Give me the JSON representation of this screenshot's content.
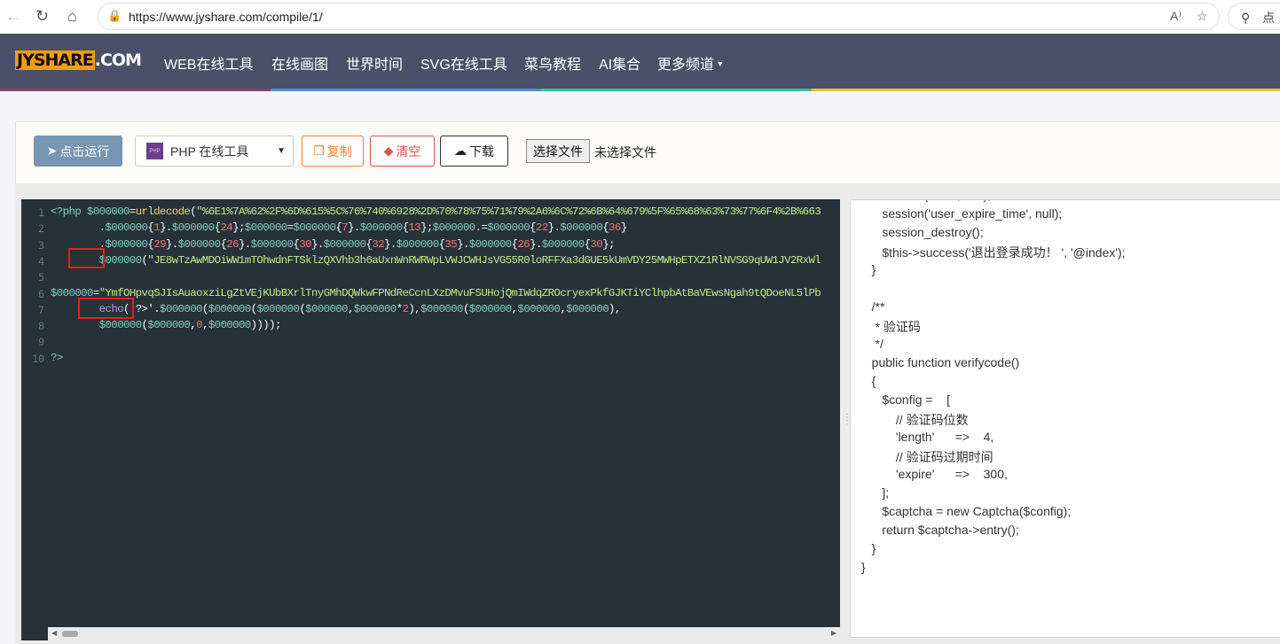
{
  "browser": {
    "url": "https://www.jyshare.com/compile/1/",
    "read_aloud": "A⁾",
    "search_text": "点"
  },
  "nav": {
    "logo_left": "JYSHARE",
    "logo_right": ".COM",
    "items": [
      "WEB在线工具",
      "在线画图",
      "世界时间",
      "SVG在线工具",
      "菜鸟教程",
      "AI集合",
      "更多频道"
    ]
  },
  "stripe_colors": [
    "#8e3f68",
    "#4a8fd6",
    "#2ec48e",
    "#f0c030"
  ],
  "toolbar": {
    "run": "点击运行",
    "language": "PHP 在线工具",
    "php_badge": "PHP",
    "copy": "复制",
    "clear": "清空",
    "download": "下载",
    "choose_file": "选择文件",
    "no_file": "未选择文件"
  },
  "editor": {
    "lines": [
      [
        [
          "t-var",
          "<?php $000000"
        ],
        [
          "t-op",
          "="
        ],
        [
          "t-fn",
          "urldecode"
        ],
        [
          "t-op",
          "("
        ],
        [
          "t-str",
          "\"%6E1%7A%62%2F%6D%615%5C%76%740%6928%2D%70%78%75%71%79%2A6%6C%72%6B%64%679%5F%65%68%63%73%77%6F4%2B%663"
        ]
      ],
      [
        [
          "t-op",
          "        ."
        ],
        [
          "t-var",
          "$000000"
        ],
        [
          "t-op",
          "{"
        ],
        [
          "t-num",
          "1"
        ],
        [
          "t-op",
          "}."
        ],
        [
          "t-var",
          "$000000"
        ],
        [
          "t-op",
          "{"
        ],
        [
          "t-num",
          "24"
        ],
        [
          "t-op",
          "};"
        ],
        [
          "t-var",
          "$000000"
        ],
        [
          "t-op",
          "="
        ],
        [
          "t-var",
          "$000000"
        ],
        [
          "t-op",
          "{"
        ],
        [
          "t-num",
          "7"
        ],
        [
          "t-op",
          "}."
        ],
        [
          "t-var",
          "$000000"
        ],
        [
          "t-op",
          "{"
        ],
        [
          "t-num",
          "13"
        ],
        [
          "t-op",
          "};"
        ],
        [
          "t-var",
          "$000000"
        ],
        [
          "t-op",
          ".="
        ],
        [
          "t-var",
          "$000000"
        ],
        [
          "t-op",
          "{"
        ],
        [
          "t-num",
          "22"
        ],
        [
          "t-op",
          "}."
        ],
        [
          "t-var",
          "$000000"
        ],
        [
          "t-op",
          "{"
        ],
        [
          "t-num",
          "36"
        ],
        [
          "t-op",
          "}"
        ]
      ],
      [
        [
          "t-op",
          "        ."
        ],
        [
          "t-var",
          "$000000"
        ],
        [
          "t-op",
          "{"
        ],
        [
          "t-num",
          "29"
        ],
        [
          "t-op",
          "}."
        ],
        [
          "t-var",
          "$000000"
        ],
        [
          "t-op",
          "{"
        ],
        [
          "t-num",
          "26"
        ],
        [
          "t-op",
          "}."
        ],
        [
          "t-var",
          "$000000"
        ],
        [
          "t-op",
          "{"
        ],
        [
          "t-num",
          "30"
        ],
        [
          "t-op",
          "}."
        ],
        [
          "t-var",
          "$000000"
        ],
        [
          "t-op",
          "{"
        ],
        [
          "t-num",
          "32"
        ],
        [
          "t-op",
          "}."
        ],
        [
          "t-var",
          "$000000"
        ],
        [
          "t-op",
          "{"
        ],
        [
          "t-num",
          "35"
        ],
        [
          "t-op",
          "}."
        ],
        [
          "t-var",
          "$000000"
        ],
        [
          "t-op",
          "{"
        ],
        [
          "t-num",
          "26"
        ],
        [
          "t-op",
          "}."
        ],
        [
          "t-var",
          "$000000"
        ],
        [
          "t-op",
          "{"
        ],
        [
          "t-num",
          "30"
        ],
        [
          "t-op",
          "};"
        ]
      ],
      [
        [
          "t-var",
          "        $000000"
        ],
        [
          "t-op",
          "("
        ],
        [
          "t-str",
          "\"JE8wTzAwMDOiWW1mTOhwdnFTSklzQXVhb3h6aUxnWnRWRWpLVWJCWHJsVG55R0loRFFXa3dGUE5kUmVDY25MWHpETXZ1RlNVSG9qUW1JV2RxWl"
        ]
      ],
      [
        [
          "t-op",
          ""
        ]
      ],
      [
        [
          "t-var",
          "$000000"
        ],
        [
          "t-op",
          "="
        ],
        [
          "t-str",
          "\"YmfOHpvqSJIsAuaoxziLgZtVEjKUbBXrlTnyGMhDQWkwFPNdReCcnLXzDMvuFSUHojQmIWdqZROcryexPkfGJKTiYClhpbAtBaVEwsNgah9tQDoeNL5lPb"
        ]
      ],
      [
        [
          "t-kw",
          "        echo"
        ],
        [
          "t-op",
          "( ?>'."
        ],
        [
          "t-var",
          "$000000"
        ],
        [
          "t-op",
          "("
        ],
        [
          "t-var",
          "$000000"
        ],
        [
          "t-op",
          "("
        ],
        [
          "t-var",
          "$000000"
        ],
        [
          "t-op",
          "("
        ],
        [
          "t-var",
          "$000000"
        ],
        [
          "t-op",
          ","
        ],
        [
          "t-var",
          "$000000"
        ],
        [
          "t-op",
          "*"
        ],
        [
          "t-num",
          "2"
        ],
        [
          "t-op",
          "),"
        ],
        [
          "t-var",
          "$000000"
        ],
        [
          "t-op",
          "("
        ],
        [
          "t-var",
          "$000000"
        ],
        [
          "t-op",
          ","
        ],
        [
          "t-var",
          "$000000"
        ],
        [
          "t-op",
          ","
        ],
        [
          "t-var",
          "$000000"
        ],
        [
          "t-op",
          "),"
        ]
      ],
      [
        [
          "t-var",
          "        $000000"
        ],
        [
          "t-op",
          "("
        ],
        [
          "t-var",
          "$000000"
        ],
        [
          "t-op",
          ","
        ],
        [
          "t-num",
          "0"
        ],
        [
          "t-op",
          ","
        ],
        [
          "t-var",
          "$000000"
        ],
        [
          "t-op",
          "))));"
        ]
      ],
      [
        [
          "t-op",
          ""
        ]
      ],
      [
        [
          "t-var",
          "?>"
        ]
      ]
    ]
  },
  "output": {
    "lines": [
      "      session('user', null);",
      "      session('user_expire_time', null);",
      "      session_destroy();",
      "      $this->success('退出登录成功！ ', '@index');",
      "   }",
      "",
      "   /**",
      "    * 验证码",
      "    */",
      "   public function verifycode()",
      "   {",
      "      $config =    [",
      "          // 验证码位数",
      "          'length'      =>    4,",
      "          // 验证码过期时间",
      "          'expire'      =>    300,",
      "      ];",
      "      $captcha = new Captcha($config);",
      "      return $captcha->entry();",
      "   }",
      "}"
    ]
  }
}
